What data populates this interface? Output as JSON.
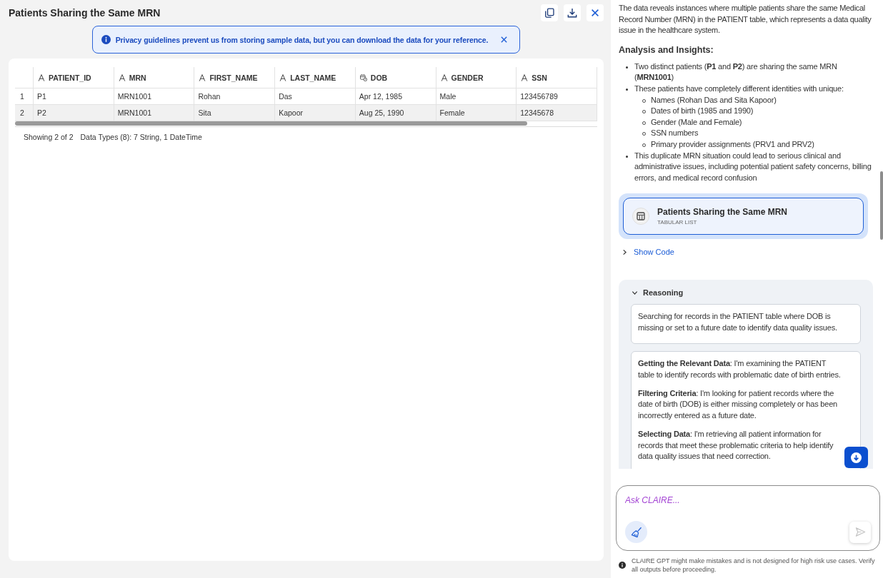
{
  "panel": {
    "title": "Patients Sharing the Same MRN",
    "banner": {
      "text": "Privacy guidelines prevent us from storing sample data, but you can download the data for your reference."
    },
    "table": {
      "columns": [
        {
          "label": "PATIENT_ID",
          "kind": "string"
        },
        {
          "label": "MRN",
          "kind": "string"
        },
        {
          "label": "FIRST_NAME",
          "kind": "string"
        },
        {
          "label": "LAST_NAME",
          "kind": "string"
        },
        {
          "label": "DOB",
          "kind": "datetime"
        },
        {
          "label": "GENDER",
          "kind": "string"
        },
        {
          "label": "SSN",
          "kind": "string"
        }
      ],
      "rows": [
        {
          "index": "1",
          "cells": [
            "P1",
            "MRN1001",
            "Rohan",
            "Das",
            "Apr 12, 1985",
            "Male",
            "123456789"
          ]
        },
        {
          "index": "2",
          "cells": [
            "P2",
            "MRN1001",
            "Sita",
            "Kapoor",
            "Aug 25, 1990",
            "Female",
            "12345678"
          ]
        }
      ]
    },
    "footer": {
      "count": "Showing 2 of 2",
      "data_types": "Data Types (8): 7 String, 1 DateTime"
    }
  },
  "chat": {
    "summary": "The data reveals instances where multiple patients share the same Medical Record Number (MRN) in the PATIENT table, which represents a data quality issue in the healthcare system.",
    "heading": "Analysis and Insights:",
    "insights": [
      {
        "text": "Two distinct patients (**P1** and **P2**) are sharing the same MRN (**MRN1001**)"
      },
      {
        "text": "These patients have completely different identities with unique:",
        "children": [
          {
            "text": "Names (Rohan Das and Sita Kapoor)"
          },
          {
            "text": "Dates of birth (1985 and 1990)"
          },
          {
            "text": "Gender (Male and Female)"
          },
          {
            "text": "SSN numbers"
          },
          {
            "text": "Primary provider assignments (PRV1 and PRV2)"
          }
        ]
      },
      {
        "text": "This duplicate MRN situation could lead to serious clinical and administrative issues, including potential patient safety concerns, billing errors, and medical record confusion"
      }
    ],
    "artifact": {
      "title": "Patients Sharing the Same MRN",
      "subtitle": "TABULAR LIST",
      "open": true
    },
    "show_code": {
      "label": "Show Code",
      "expanded": false
    },
    "reasoning": {
      "title": "Reasoning",
      "expanded": true,
      "steps": [
        {
          "paragraphs": [
            "Searching for records in the PATIENT table where DOB is missing or set to a future date to identify data quality issues."
          ]
        },
        {
          "paragraphs": [
            "**Getting the Relevant Data**: I'm examining the PATIENT table to identify records with problematic date of birth entries.",
            "**Filtering Criteria**: I'm looking for patient records where the date of birth (DOB) is either missing completely or has been incorrectly entered as a future date.",
            "**Selecting Data**: I'm retrieving all patient information for records that meet these problematic criteria to help identify data quality issues that need correction."
          ]
        }
      ]
    }
  },
  "composer": {
    "placeholder": "Ask CLAIRE...",
    "send_button": {
      "disabled": true
    },
    "disclaimer": "CLAIRE GPT might make mistakes and is not designed for high risk use cases. Verify all outputs before proceeding."
  }
}
